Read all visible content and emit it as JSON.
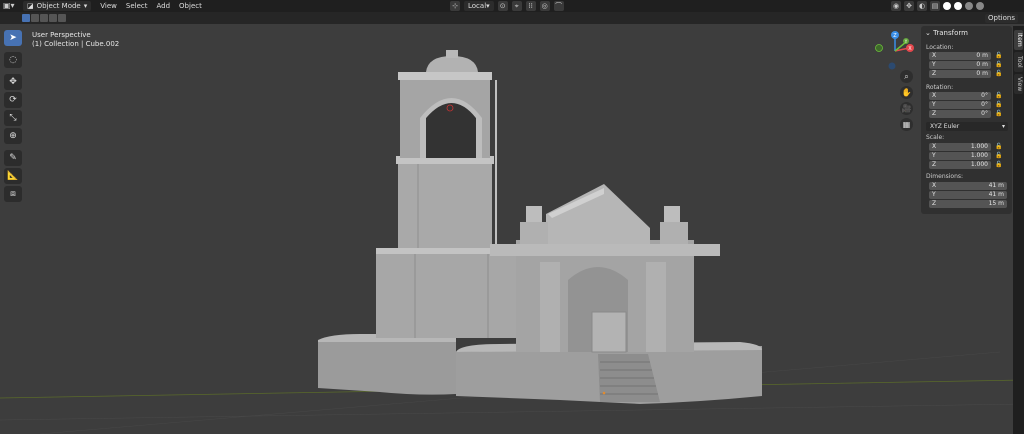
{
  "header": {
    "mode": "Object Mode",
    "menus": [
      "View",
      "Select",
      "Add",
      "Object"
    ],
    "transform_orientation": "Local",
    "options_label": "Options"
  },
  "viewport": {
    "perspective": "User Perspective",
    "collection": "(1) Collection | Cube.002"
  },
  "sidebar_tabs": [
    "Item",
    "Tool",
    "View"
  ],
  "transform": {
    "title": "Transform",
    "location_label": "Location:",
    "location": [
      {
        "axis": "X",
        "value": "0 m"
      },
      {
        "axis": "Y",
        "value": "0 m"
      },
      {
        "axis": "Z",
        "value": "0 m"
      }
    ],
    "rotation_label": "Rotation:",
    "rotation": [
      {
        "axis": "X",
        "value": "0°"
      },
      {
        "axis": "Y",
        "value": "0°"
      },
      {
        "axis": "Z",
        "value": "0°"
      }
    ],
    "rotation_mode": "XYZ Euler",
    "scale_label": "Scale:",
    "scale": [
      {
        "axis": "X",
        "value": "1.000"
      },
      {
        "axis": "Y",
        "value": "1.000"
      },
      {
        "axis": "Z",
        "value": "1.000"
      }
    ],
    "dimensions_label": "Dimensions:",
    "dimensions": [
      {
        "axis": "X",
        "value": "41 m"
      },
      {
        "axis": "Y",
        "value": "41 m"
      },
      {
        "axis": "Z",
        "value": "15 m"
      }
    ]
  },
  "gizmo": {
    "x_label": "X",
    "y_label": "Y",
    "z_label": "Z",
    "x_color": "#e5484d",
    "y_color": "#6dbf3b",
    "z_color": "#3a8ee6"
  },
  "colors": {
    "accent": "#4772b3",
    "viewport_bg": "#3d3d3d"
  }
}
